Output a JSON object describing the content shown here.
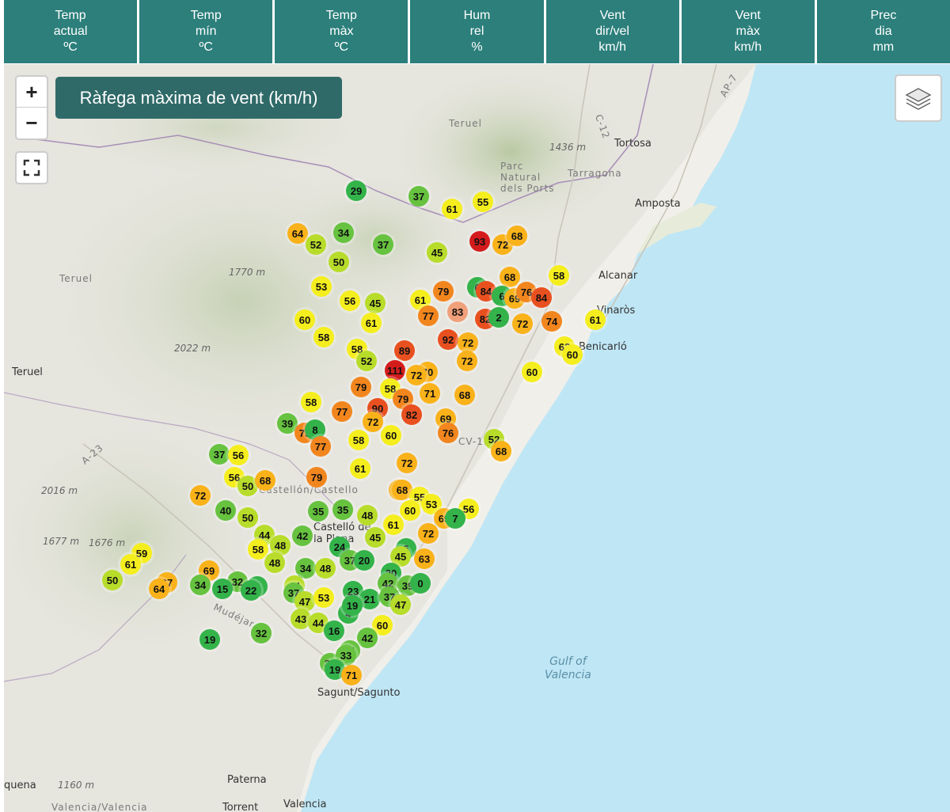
{
  "tabs": [
    {
      "l1": "Temp",
      "l2": "actual",
      "l3": "ºC"
    },
    {
      "l1": "Temp",
      "l2": "mín",
      "l3": "ºC"
    },
    {
      "l1": "Temp",
      "l2": "màx",
      "l3": "ºC"
    },
    {
      "l1": "Hum",
      "l2": "rel",
      "l3": "%"
    },
    {
      "l1": "Vent",
      "l2": "dir/vel",
      "l3": "km/h"
    },
    {
      "l1": "Vent",
      "l2": "màx",
      "l3": "km/h"
    },
    {
      "l1": "Prec",
      "l2": "dia",
      "l3": "mm"
    }
  ],
  "map": {
    "title": "Ràfega màxima de vent (km/h)",
    "zoom_in": "+",
    "zoom_out": "−",
    "places": [
      {
        "text": "Teruel",
        "cls": "light"
      },
      {
        "text": "Tortosa",
        "cls": ""
      },
      {
        "text": "1436 m",
        "cls": "italic"
      },
      {
        "text": "Parc\nNatural\ndels Ports",
        "cls": "light"
      },
      {
        "text": "Tarragona",
        "cls": "light"
      },
      {
        "text": "Amposta",
        "cls": ""
      },
      {
        "text": "Teruel",
        "cls": "light"
      },
      {
        "text": "1770 m",
        "cls": "italic"
      },
      {
        "text": "Alcanar",
        "cls": ""
      },
      {
        "text": "Vinaròs",
        "cls": ""
      },
      {
        "text": "Benicarló",
        "cls": ""
      },
      {
        "text": "2022 m",
        "cls": "italic"
      },
      {
        "text": "Teruel",
        "cls": ""
      },
      {
        "text": "CV-13",
        "cls": "light"
      },
      {
        "text": "A-23",
        "cls": "light"
      },
      {
        "text": "2016 m",
        "cls": "italic"
      },
      {
        "text": "Castellón/Castello",
        "cls": "light"
      },
      {
        "text": "Castelló de\nla Plana",
        "cls": ""
      },
      {
        "text": "1677 m",
        "cls": "italic"
      },
      {
        "text": "1676 m",
        "cls": "italic"
      },
      {
        "text": "Mudéjar",
        "cls": "light"
      },
      {
        "text": "Gulf of\nValencia",
        "cls": "sea"
      },
      {
        "text": "Sagunt/Sagunto",
        "cls": ""
      },
      {
        "text": "Paterna",
        "cls": ""
      },
      {
        "text": "quena",
        "cls": ""
      },
      {
        "text": "1160 m",
        "cls": "italic"
      },
      {
        "text": "Valencia/Valencia",
        "cls": "light"
      },
      {
        "text": "Torrent",
        "cls": ""
      },
      {
        "text": "Valencia",
        "cls": ""
      },
      {
        "text": "C-12",
        "cls": "light"
      },
      {
        "text": "AP-7",
        "cls": "light"
      }
    ],
    "stations": [
      29,
      37,
      61,
      55,
      64,
      52,
      34,
      37,
      93,
      72,
      68,
      50,
      45,
      58,
      68,
      53,
      56,
      45,
      61,
      79,
      6,
      84,
      6,
      69,
      76,
      84,
      60,
      61,
      77,
      83,
      82,
      2,
      72,
      74,
      61,
      58,
      58,
      52,
      89,
      92,
      72,
      60,
      62,
      60,
      111,
      70,
      72,
      72,
      79,
      58,
      79,
      71,
      68,
      58,
      90,
      82,
      69,
      39,
      75,
      8,
      77,
      72,
      58,
      60,
      76,
      52,
      68,
      77,
      37,
      56,
      72,
      56,
      50,
      68,
      79,
      61,
      72,
      72,
      68,
      55,
      53,
      56,
      40,
      50,
      35,
      35,
      48,
      60,
      69,
      7,
      61,
      44,
      42,
      45,
      59,
      58,
      48,
      24,
      6,
      72,
      61,
      48,
      34,
      48,
      37,
      20,
      45,
      63,
      67,
      64,
      69,
      32,
      8,
      50,
      20,
      42,
      39,
      0,
      34,
      15,
      22,
      44,
      37,
      47,
      53,
      23,
      21,
      37,
      47,
      43,
      44,
      4,
      19,
      60,
      16,
      42,
      32,
      19,
      31,
      36,
      33,
      19,
      71
    ],
    "colors": {
      "green_dark": "#33b34a",
      "green": "#66c23f",
      "lime": "#b8dc2a",
      "yellow": "#f5ee1e",
      "orange_light": "#f9b21a",
      "orange": "#f2861e",
      "red_orange": "#e9501f",
      "red": "#d41c1c",
      "salmon": "#f0a07a"
    },
    "icons": [
      "zoom-in-icon",
      "zoom-out-icon",
      "fullscreen-icon",
      "layers-icon"
    ]
  }
}
